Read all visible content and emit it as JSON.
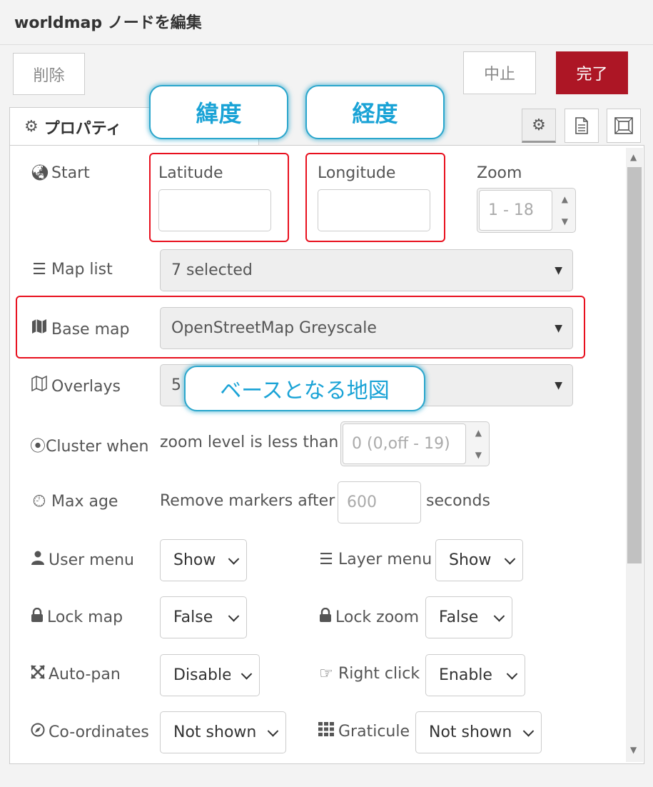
{
  "header": {
    "title": "worldmap ノードを編集"
  },
  "toolbar": {
    "delete_label": "削除",
    "cancel_label": "中止",
    "done_label": "完了"
  },
  "tabs": {
    "properties_label": "プロパティ"
  },
  "form": {
    "start": {
      "label": "Start",
      "lat_label": "Latitude",
      "lon_label": "Longitude",
      "zoom_label": "Zoom",
      "zoom_placeholder": "1 - 18"
    },
    "map_list": {
      "label": "Map list",
      "value": "7 selected"
    },
    "base_map": {
      "label": "Base map",
      "value": "OpenStreetMap Greyscale"
    },
    "overlays": {
      "label": "Overlays",
      "value": "5"
    },
    "cluster": {
      "label": "Cluster when",
      "text": "zoom level is less than",
      "placeholder": "0 (0,off - 19)"
    },
    "max_age": {
      "label": "Max age",
      "text": "Remove markers after",
      "placeholder": "600",
      "unit": "seconds"
    },
    "user_menu": {
      "label": "User menu",
      "value": "Show"
    },
    "layer_menu": {
      "label": "Layer menu",
      "value": "Show"
    },
    "lock_map": {
      "label": "Lock map",
      "value": "False"
    },
    "lock_zoom": {
      "label": "Lock zoom",
      "value": "False"
    },
    "auto_pan": {
      "label": "Auto-pan",
      "value": "Disable"
    },
    "right_click": {
      "label": "Right click",
      "value": "Enable"
    },
    "coordinates": {
      "label": "Co-ordinates",
      "value": "Not shown"
    },
    "graticule": {
      "label": "Graticule",
      "value": "Not shown"
    }
  },
  "callouts": {
    "latitude": "緯度",
    "longitude": "経度",
    "base_map": "ベースとなる地図"
  },
  "colors": {
    "done_button": "#ad1625",
    "highlight_box": "#e8101e",
    "callout_text": "#1aa3d6"
  }
}
